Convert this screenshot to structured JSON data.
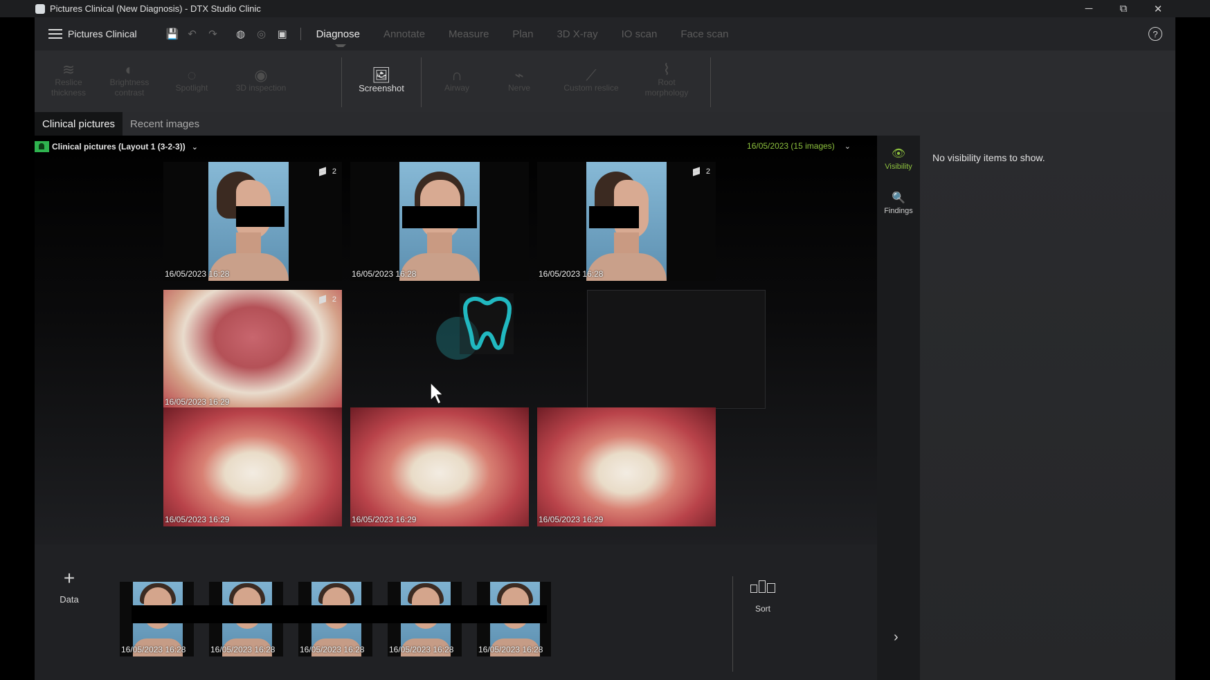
{
  "window": {
    "title": "Pictures Clinical (New Diagnosis) - DTX Studio Clinic",
    "minimize_glyph": "─",
    "maximize_glyph": "⧉",
    "close_glyph": "✕"
  },
  "topnav": {
    "module": "Pictures Clinical",
    "tools": [
      {
        "icon": "save-icon",
        "glyph": "💾"
      },
      {
        "icon": "undo-icon",
        "glyph": "↶"
      },
      {
        "icon": "redo-icon",
        "glyph": "↷"
      },
      {
        "icon": "aperture-icon",
        "glyph": "◍"
      },
      {
        "icon": "crop-circle-icon",
        "glyph": "◎"
      },
      {
        "icon": "image-icon",
        "glyph": "▣"
      }
    ],
    "tabs": [
      "Diagnose",
      "Annotate",
      "Measure",
      "Plan",
      "3D X-ray",
      "IO scan",
      "Face scan"
    ],
    "active_tab": "Diagnose",
    "help_glyph": "?"
  },
  "ribbon": {
    "tools": [
      {
        "label": "Reslice thickness",
        "glyph": "≋",
        "enabled": false
      },
      {
        "label": "Brightness contrast",
        "glyph": "◐",
        "enabled": false
      },
      {
        "label": "Spotlight",
        "glyph": "◌",
        "enabled": false
      },
      {
        "label": "3D inspection",
        "glyph": "◉",
        "enabled": false
      },
      {
        "label": "Screenshot",
        "glyph": "🖼",
        "enabled": true
      },
      {
        "label": "Airway",
        "glyph": "∩",
        "enabled": false
      },
      {
        "label": "Nerve",
        "glyph": "⌁",
        "enabled": false
      },
      {
        "label": "Custom reslice",
        "glyph": "⟋",
        "enabled": false
      },
      {
        "label": "Root morphology",
        "glyph": "⌇",
        "enabled": false
      }
    ]
  },
  "subtabs": [
    "Clinical pictures",
    "Recent images"
  ],
  "viewer": {
    "layout_label": "Clinical pictures (Layout 1 (3-2-3))",
    "date_label": "16/05/2023 (15 images)",
    "tiles": [
      {
        "caption": "16/05/2023 16:28",
        "stack": "2"
      },
      {
        "caption": "16/05/2023 16:28",
        "stack": ""
      },
      {
        "caption": "16/05/2023 16:28",
        "stack": "2"
      },
      {
        "caption": "16/05/2023 16:29",
        "stack": "2"
      },
      {
        "caption": "16/05/2023 16:29",
        "stack": ""
      },
      {
        "caption": "16/05/2023 16:29",
        "stack": ""
      },
      {
        "caption": "16/05/2023 16:29",
        "stack": ""
      }
    ]
  },
  "filmstrip": {
    "add_label": "Data",
    "add_glyph": "+",
    "thumbs": [
      "16/05/2023 16:28",
      "16/05/2023 16:28",
      "16/05/2023 16:28",
      "16/05/2023 16:28",
      "16/05/2023 16:28"
    ],
    "sort_label": "Sort"
  },
  "side_icons": {
    "visibility_label": "Visibility",
    "visibility_glyph": "👁",
    "findings_label": "Findings",
    "findings_glyph": "🔍",
    "expand_glyph": "›"
  },
  "panel": {
    "message": "No visibility items to show."
  },
  "colors": {
    "accent_green": "#8ec23e",
    "tooth_teal": "#21b8c0",
    "layout_icon_green": "#2fb34f"
  }
}
